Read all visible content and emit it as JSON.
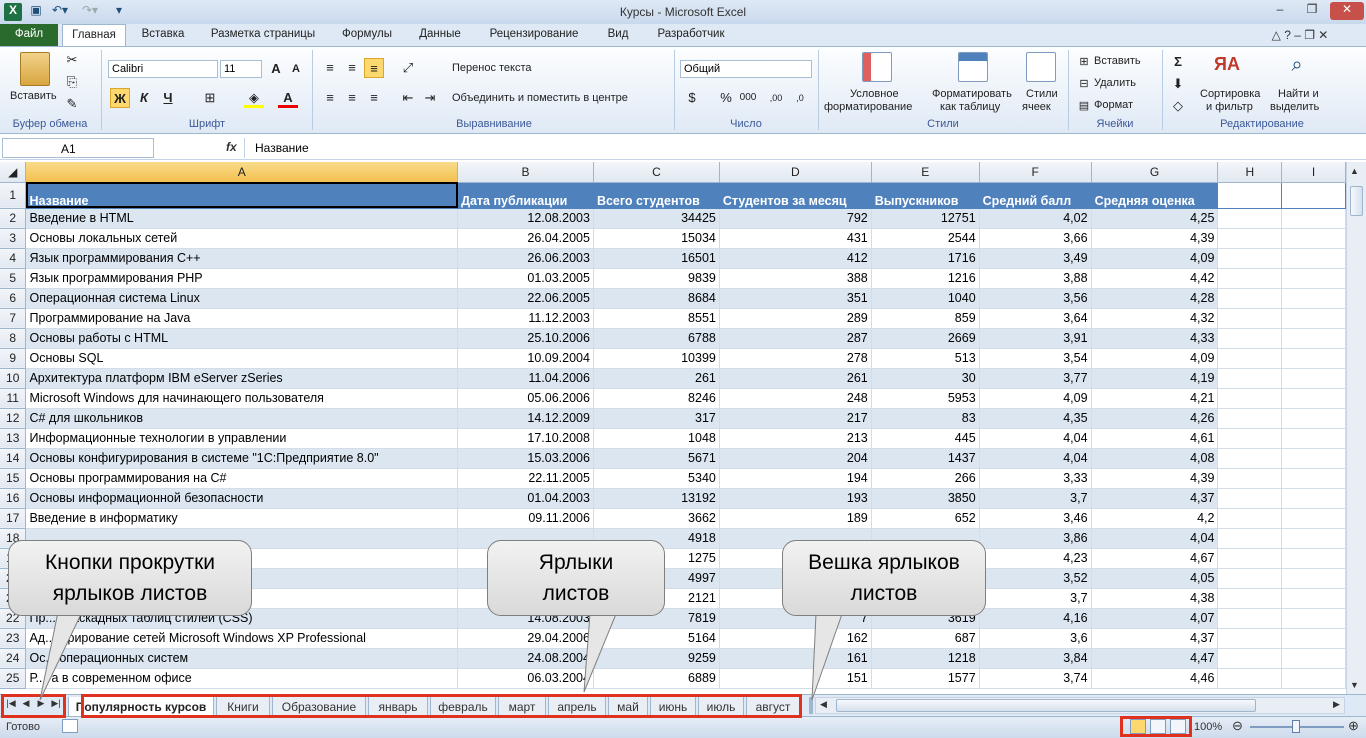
{
  "window": {
    "title": "Курсы  -  Microsoft Excel"
  },
  "tabs": {
    "file": "Файл",
    "items": [
      "Главная",
      "Вставка",
      "Разметка страницы",
      "Формулы",
      "Данные",
      "Рецензирование",
      "Вид",
      "Разработчик"
    ],
    "active": "Главная"
  },
  "ribbon": {
    "clipboard": {
      "paste": "Вставить",
      "label": "Буфер обмена"
    },
    "font": {
      "name": "Calibri",
      "size": "11",
      "bold": "Ж",
      "italic": "К",
      "underline": "Ч",
      "label": "Шрифт"
    },
    "alignment": {
      "wrap": "Перенос текста",
      "merge": "Объединить и поместить в центре",
      "label": "Выравнивание"
    },
    "number": {
      "format": "Общий",
      "label": "Число"
    },
    "styles": {
      "conditional1": "Условное",
      "conditional2": "форматирование",
      "astable1": "Форматировать",
      "astable2": "как таблицу",
      "cell1": "Стили",
      "cell2": "ячеек",
      "label": "Стили"
    },
    "cells": {
      "insert": "Вставить",
      "delete": "Удалить",
      "format": "Формат",
      "label": "Ячейки"
    },
    "editing": {
      "sort1": "Сортировка",
      "sort2": "и фильтр",
      "find1": "Найти и",
      "find2": "выделить",
      "label": "Редактирование"
    }
  },
  "formula_bar": {
    "cell": "A1",
    "fx": "fx",
    "value": "Название"
  },
  "columns": [
    "A",
    "B",
    "C",
    "D",
    "E",
    "F",
    "G",
    "H",
    "I"
  ],
  "header_row": [
    "Название",
    "Дата публикации",
    "Всего студентов",
    "Студентов за месяц",
    "Выпускников",
    "Средний балл",
    "Средняя оценка"
  ],
  "rows": [
    [
      "Введение в HTML",
      "12.08.2003",
      "34425",
      "792",
      "12751",
      "4,02",
      "4,25"
    ],
    [
      "Основы локальных сетей",
      "26.04.2005",
      "15034",
      "431",
      "2544",
      "3,66",
      "4,39"
    ],
    [
      "Язык программирования C++",
      "26.06.2003",
      "16501",
      "412",
      "1716",
      "3,49",
      "4,09"
    ],
    [
      "Язык программирования PHP",
      "01.03.2005",
      "9839",
      "388",
      "1216",
      "3,88",
      "4,42"
    ],
    [
      "Операционная система Linux",
      "22.06.2005",
      "8684",
      "351",
      "1040",
      "3,56",
      "4,28"
    ],
    [
      "Программирование на Java",
      "11.12.2003",
      "8551",
      "289",
      "859",
      "3,64",
      "4,32"
    ],
    [
      "Основы работы с HTML",
      "25.10.2006",
      "6788",
      "287",
      "2669",
      "3,91",
      "4,33"
    ],
    [
      "Основы SQL",
      "10.09.2004",
      "10399",
      "278",
      "513",
      "3,54",
      "4,09"
    ],
    [
      "Архитектура платформ IBM eServer zSeries",
      "11.04.2006",
      "261",
      "261",
      "30",
      "3,77",
      "4,19"
    ],
    [
      "Microsoft Windows для начинающего пользователя",
      "05.06.2006",
      "8246",
      "248",
      "5953",
      "4,09",
      "4,21"
    ],
    [
      "C# для школьников",
      "14.12.2009",
      "317",
      "217",
      "83",
      "4,35",
      "4,26"
    ],
    [
      "Информационные технологии в управлении",
      "17.10.2008",
      "1048",
      "213",
      "445",
      "4,04",
      "4,61"
    ],
    [
      "Основы конфигурирования в системе \"1С:Предприятие 8.0\"",
      "15.03.2006",
      "5671",
      "204",
      "1437",
      "4,04",
      "4,08"
    ],
    [
      "Основы программирования на C#",
      "22.11.2005",
      "5340",
      "194",
      "266",
      "3,33",
      "4,39"
    ],
    [
      "Основы информационной безопасности",
      "01.04.2003",
      "13192",
      "193",
      "3850",
      "3,7",
      "4,37"
    ],
    [
      "Введение в информатику",
      "09.11.2006",
      "3662",
      "189",
      "652",
      "3,46",
      "4,2"
    ],
    [
      "",
      "",
      "4918",
      "",
      "",
      "3,86",
      "4,04"
    ],
    [
      "",
      "",
      "1275",
      "",
      "",
      "4,23",
      "4,67"
    ],
    [
      "ке C",
      "",
      "4997",
      "",
      "",
      "3,52",
      "4,05"
    ],
    [
      "Delphi",
      "",
      "2121",
      "",
      "",
      "3,7",
      "4,38"
    ],
    [
      "Пр...е каскадных таблиц стилей (CSS)",
      "14.08.2003",
      "7819",
      "7",
      "3619",
      "4,16",
      "4,07"
    ],
    [
      "Ад...стрирование сетей Microsoft Windows XP Professional",
      "29.04.2006",
      "5164",
      "162",
      "687",
      "3,6",
      "4,37"
    ],
    [
      "Ос... операционных систем",
      "24.08.2004",
      "9259",
      "161",
      "1218",
      "3,84",
      "4,47"
    ],
    [
      "Р...та в современном офисе",
      "06.03.2004",
      "6889",
      "151",
      "1577",
      "3,74",
      "4,46"
    ]
  ],
  "sheets": [
    "Популярность курсов",
    "Книги",
    "Образование",
    "январь",
    "февраль",
    "март",
    "апрель",
    "май",
    "июнь",
    "июль",
    "август"
  ],
  "active_sheet": "Популярность курсов",
  "status": {
    "ready": "Готово",
    "zoom": "100%"
  },
  "callouts": [
    {
      "line1": "Кнопки прокрутки",
      "line2": "ярлыков листов"
    },
    {
      "line1": "Ярлыки",
      "line2": "листов"
    },
    {
      "line1": "Вешка ярлыков",
      "line2": "листов"
    }
  ],
  "colors": {
    "header_fill": "#4f81bd",
    "band_fill": "#dce6f1",
    "file_tab": "#2a6a2d",
    "highlight": "#e0301e"
  }
}
